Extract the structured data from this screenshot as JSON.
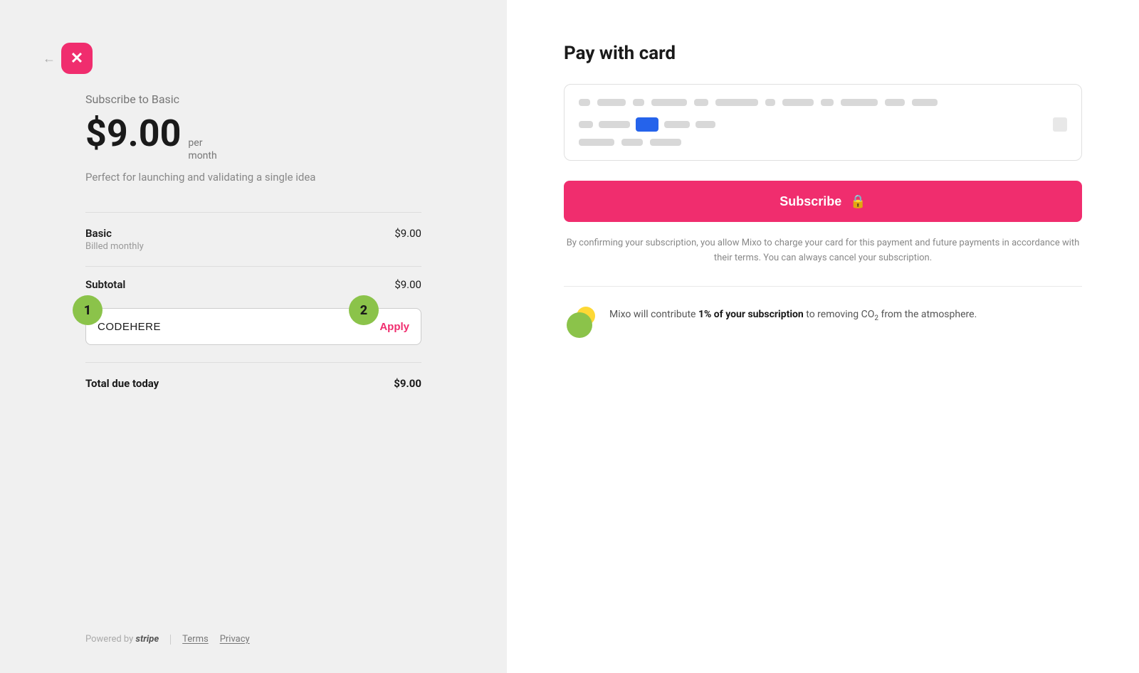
{
  "left": {
    "back_label": "←",
    "brand_icon": "✕",
    "subscribe_label": "Subscribe to Basic",
    "price": "$9.00",
    "price_period_line1": "per",
    "price_period_line2": "month",
    "description": "Perfect for launching and validating a single idea",
    "line_item": {
      "name": "Basic",
      "sub": "Billed monthly",
      "price": "$9.00"
    },
    "subtotal_label": "Subtotal",
    "subtotal_price": "$9.00",
    "promo_badge_1": "1",
    "promo_badge_2": "2",
    "promo_placeholder": "CODEHERE",
    "apply_label": "Apply",
    "total_label": "Total due today",
    "total_price": "$9.00",
    "powered_by": "Powered by",
    "stripe": "stripe",
    "terms": "Terms",
    "privacy": "Privacy"
  },
  "right": {
    "title": "Pay with card",
    "subscribe_button": "Subscribe",
    "consent_text": "By confirming your subscription, you allow Mixo to charge your card for this payment and future payments in accordance with their terms. You can always cancel your subscription.",
    "eco_text_part1": "Mixo will contribute ",
    "eco_highlight": "1% of your subscription",
    "eco_text_part2": " to removing CO",
    "eco_subscript": "2",
    "eco_text_part3": " from the atmosphere."
  }
}
